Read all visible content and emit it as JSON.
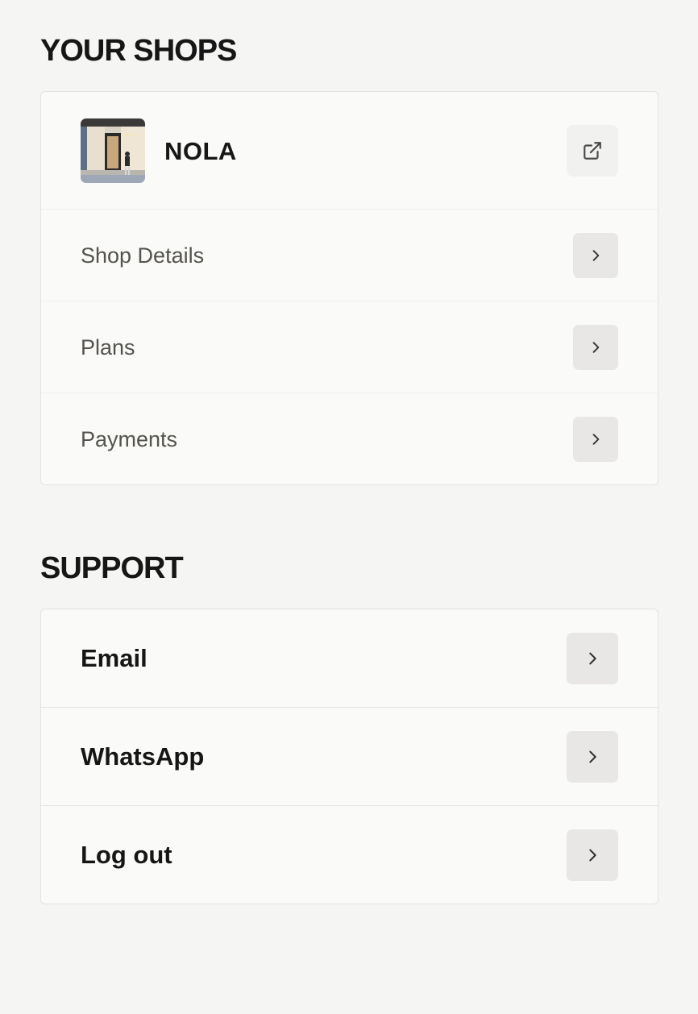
{
  "shops_section": {
    "title": "YOUR SHOPS",
    "shop": {
      "name": "NOLA",
      "thumbnail": "storefront-photo",
      "open_icon": "external-link-icon"
    },
    "menu": [
      {
        "label": "Shop Details",
        "icon": "chevron-right-icon"
      },
      {
        "label": "Plans",
        "icon": "chevron-right-icon"
      },
      {
        "label": "Payments",
        "icon": "chevron-right-icon"
      }
    ]
  },
  "support_section": {
    "title": "SUPPORT",
    "items": [
      {
        "label": "Email",
        "icon": "chevron-right-icon"
      },
      {
        "label": "WhatsApp",
        "icon": "chevron-right-icon"
      },
      {
        "label": "Log out",
        "icon": "chevron-right-icon"
      }
    ]
  },
  "colors": {
    "background": "#f5f5f3",
    "card": "#fafaf8",
    "border": "#e3e3e1",
    "button": "#e8e7e5",
    "text_primary": "#161616",
    "text_secondary": "#55534f"
  }
}
